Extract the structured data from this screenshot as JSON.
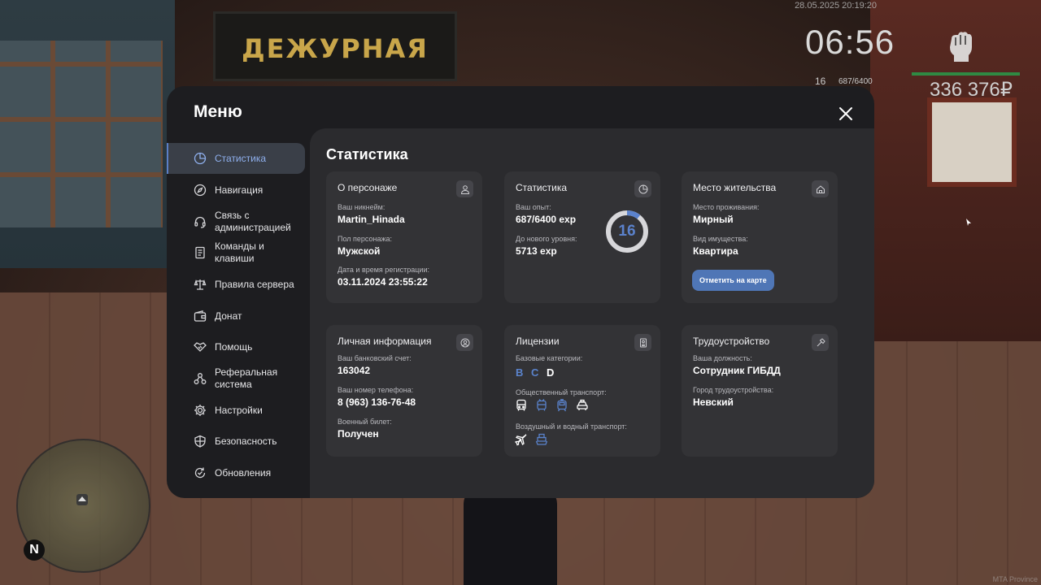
{
  "hud": {
    "datetime": "28.05.2025 20:19:20",
    "time": "06:56",
    "level": "16",
    "exp": "687/6400",
    "money": "336 376₽",
    "health_fraction": 1.0,
    "watermark": "MTA Province",
    "compass_n": "N"
  },
  "background": {
    "sign_text": "ДЕЖУРНАЯ ЧАСТЬ"
  },
  "menu": {
    "title": "Меню",
    "content_title": "Статистика"
  },
  "sidebar": {
    "items": [
      {
        "label": "Статистика",
        "icon": "pie-chart-icon",
        "active": true
      },
      {
        "label": "Навигация",
        "icon": "compass-icon",
        "active": false
      },
      {
        "label": "Связь с администрацией",
        "icon": "headset-icon",
        "active": false
      },
      {
        "label": "Команды и клавиши",
        "icon": "document-icon",
        "active": false
      },
      {
        "label": "Правила сервера",
        "icon": "scales-icon",
        "active": false
      },
      {
        "label": "Донат",
        "icon": "wallet-icon",
        "active": false
      },
      {
        "label": "Помощь",
        "icon": "handshake-icon",
        "active": false
      },
      {
        "label": "Реферальная система",
        "icon": "network-icon",
        "active": false
      },
      {
        "label": "Настройки",
        "icon": "gear-icon",
        "active": false
      },
      {
        "label": "Безопасность",
        "icon": "shield-icon",
        "active": false
      },
      {
        "label": "Обновления",
        "icon": "update-icon",
        "active": false
      }
    ]
  },
  "cards": {
    "character": {
      "title": "О персонаже",
      "nickname_label": "Ваш никнейм:",
      "nickname": "Martin_Hinada",
      "gender_label": "Пол персонажа:",
      "gender": "Мужской",
      "reg_label": "Дата и время регистрации:",
      "reg": "03.11.2024 23:55:22"
    },
    "stats": {
      "title": "Статистика",
      "exp_label": "Ваш опыт:",
      "exp": "687/6400 exp",
      "next_label": "До нового уровня:",
      "next": "5713 exp",
      "level": "16",
      "level_progress": 0.107
    },
    "residence": {
      "title": "Место жительства",
      "place_label": "Место проживания:",
      "place": "Мирный",
      "property_label": "Вид имущества:",
      "property": "Квартира",
      "map_button": "Отметить на карте"
    },
    "personal": {
      "title": "Личная информация",
      "bank_label": "Ваш банковский счет:",
      "bank": "163042",
      "phone_label": "Ваш номер телефона:",
      "phone": "8 (963) 136-76-48",
      "military_label": "Военный билет:",
      "military": "Получен"
    },
    "licenses": {
      "title": "Лицензии",
      "base_label": "Базовые категории:",
      "categories": [
        {
          "letter": "B",
          "owned": false
        },
        {
          "letter": "C",
          "owned": false
        },
        {
          "letter": "D",
          "owned": true
        }
      ],
      "public_label": "Общественный транспорт:",
      "public": [
        {
          "icon": "bus-icon",
          "owned": true
        },
        {
          "icon": "trolleybus-icon",
          "owned": false
        },
        {
          "icon": "tram-icon",
          "owned": false
        },
        {
          "icon": "taxi-icon",
          "owned": true
        }
      ],
      "air_label": "Воздушный и водный транспорт:",
      "air": [
        {
          "icon": "plane-icon",
          "owned": true
        },
        {
          "icon": "boat-icon",
          "owned": false
        }
      ]
    },
    "employment": {
      "title": "Трудоустройство",
      "position_label": "Ваша должность:",
      "position": "Сотрудник ГИБДД",
      "city_label": "Город трудоустройства:",
      "city": "Невский"
    }
  },
  "colors": {
    "accent": "#5b82cc",
    "panel": "#1d1d20",
    "content": "#2b2b2e",
    "card": "#333336",
    "button": "#4f76b6"
  }
}
